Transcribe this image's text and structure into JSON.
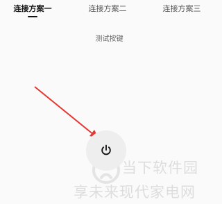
{
  "tabs": [
    {
      "label": "连接方案一",
      "active": true
    },
    {
      "label": "连接方案二",
      "active": false
    },
    {
      "label": "连接方案三",
      "active": false
    }
  ],
  "main": {
    "test_label": "测试按键"
  },
  "icons": {
    "power": "power-icon",
    "arrow": "annotation-arrow"
  },
  "colors": {
    "background": "#fafafa",
    "active_tab": "#111111",
    "inactive_tab": "#555555",
    "button_bg": "#eeeeee",
    "arrow": "#e53935"
  },
  "watermark": {
    "top_text": "当下软件园",
    "bottom_text": "享未来现代家电网"
  }
}
